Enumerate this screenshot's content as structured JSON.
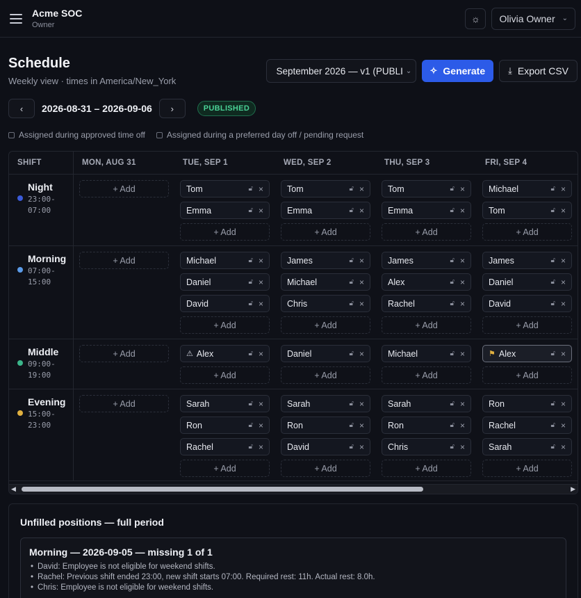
{
  "org": {
    "name": "Acme SOC",
    "role": "Owner"
  },
  "user": {
    "name": "Olivia Owner"
  },
  "page": {
    "title": "Schedule",
    "subtitle": "Weekly view · times in America/New_York"
  },
  "actions": {
    "period": "September 2026 — v1 (PUBLI",
    "generate_label": "Generate",
    "export_label": "Export CSV"
  },
  "week": {
    "range": "2026-08-31 – 2026-09-06",
    "status": "PUBLISHED"
  },
  "legend": [
    {
      "label": "Assigned during approved time off"
    },
    {
      "label": "Assigned during a preferred day off / pending request"
    }
  ],
  "grid": {
    "shift_header": "SHIFT",
    "add_label": "+ Add",
    "days": [
      "MON, AUG 31",
      "TUE, SEP 1",
      "WED, SEP 2",
      "THU, SEP 3",
      "FRI, SEP 4"
    ],
    "shifts": [
      {
        "name": "Night",
        "time1": "23:00-",
        "time2": "07:00",
        "color": "#3b5bd9",
        "cells": [
          [],
          [
            "Tom",
            "Emma"
          ],
          [
            "Tom",
            "Emma"
          ],
          [
            "Tom",
            "Emma"
          ],
          [
            "Michael",
            "Tom"
          ]
        ]
      },
      {
        "name": "Morning",
        "time1": "07:00-",
        "time2": "15:00",
        "color": "#5b9be8",
        "cells": [
          [],
          [
            "Michael",
            "Daniel",
            "David"
          ],
          [
            "James",
            "Michael",
            "Chris"
          ],
          [
            "James",
            "Alex",
            "Rachel"
          ],
          [
            "James",
            "Daniel",
            "David"
          ]
        ]
      },
      {
        "name": "Middle",
        "time1": "09:00-",
        "time2": "19:00",
        "color": "#3bb58a",
        "cells": [
          [],
          [
            "Alex"
          ],
          [
            "Daniel"
          ],
          [
            "Michael"
          ],
          [
            "Alex"
          ]
        ]
      },
      {
        "name": "Evening",
        "time1": "15:00-",
        "time2": "23:00",
        "color": "#e0b040",
        "cells": [
          [],
          [
            "Sarah",
            "Ron",
            "Rachel"
          ],
          [
            "Sarah",
            "Ron",
            "David"
          ],
          [
            "Sarah",
            "Ron",
            "Chris"
          ],
          [
            "Ron",
            "Rachel",
            "Sarah"
          ]
        ]
      }
    ]
  },
  "unfilled": {
    "title": "Unfilled positions — full period",
    "groups": [
      {
        "heading": "Morning — 2026-09-05 — missing 1 of 1",
        "reasons": [
          "David: Employee is not eligible for weekend shifts.",
          "Rachel: Previous shift ended 23:00, new shift starts 07:00. Required rest: 11h. Actual rest: 8.0h.",
          "Chris: Employee is not eligible for weekend shifts."
        ]
      }
    ]
  }
}
